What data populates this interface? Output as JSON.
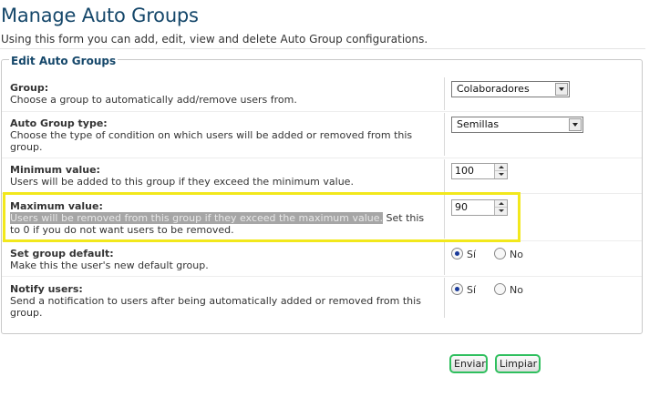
{
  "page": {
    "title": "Manage Auto Groups",
    "description": "Using this form you can add, edit, view and delete Auto Group configurations."
  },
  "fieldset": {
    "legend": "Edit Auto Groups"
  },
  "fields": {
    "group": {
      "label": "Group:",
      "description": "Choose a group to automatically add/remove users from.",
      "value": "Colaboradores"
    },
    "type": {
      "label": "Auto Group type:",
      "description": "Choose the type of condition on which users will be added or removed from this group.",
      "value": "Semillas"
    },
    "minimum": {
      "label": "Minimum value:",
      "description": "Users will be added to this group if they exceed the minimum value.",
      "value": "100"
    },
    "maximum": {
      "label": "Maximum value:",
      "description_selected": "Users will be removed from this group if they exceed the maximum value.",
      "description_rest_1": " Set this",
      "description_rest_2": "to 0 if you do not want users to be removed.",
      "value": "90"
    },
    "default": {
      "label": "Set group default:",
      "description": "Make this the user's new default group.",
      "yes_label": "Sí",
      "no_label": "No",
      "selected": "yes"
    },
    "notify": {
      "label": "Notify users:",
      "description": "Send a notification to users after being automatically added or removed from this group.",
      "yes_label": "Sí",
      "no_label": "No",
      "selected": "yes"
    }
  },
  "actions": {
    "submit_label": "Enviar",
    "reset_label": "Limpiar"
  },
  "colors": {
    "title": "#15476a",
    "highlight": "#f2e81c",
    "button_border": "#2fbf5e"
  }
}
